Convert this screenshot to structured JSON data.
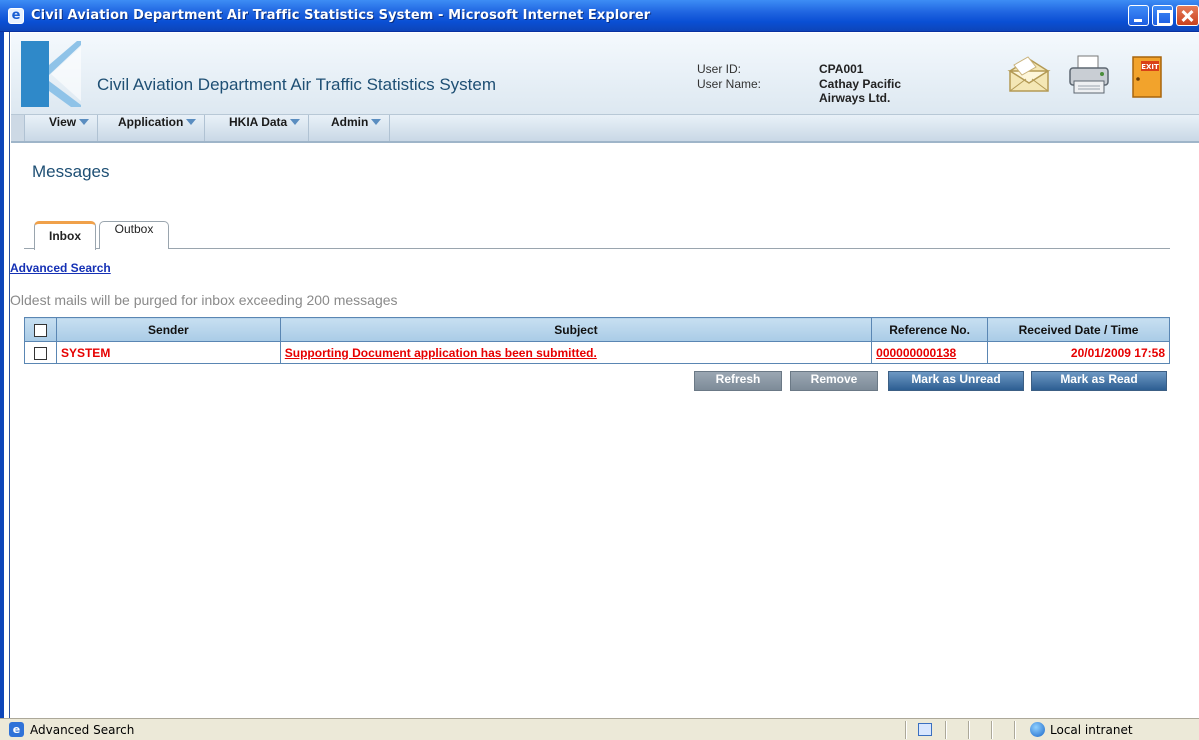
{
  "window": {
    "title": "Civil Aviation Department Air Traffic Statistics System - Microsoft Internet Explorer",
    "ie_glyph": "e"
  },
  "header": {
    "app_title": "Civil Aviation Department Air Traffic Statistics System",
    "user_id_label": "User ID:",
    "user_id": "CPA001",
    "user_name_label": "User Name:",
    "user_name_line1": "Cathay Pacific",
    "user_name_line2": "Airways Ltd.",
    "icons": [
      "envelope-icon",
      "printer-icon",
      "exit-door-icon"
    ],
    "exit_text": "EXIT"
  },
  "menu": {
    "items": [
      {
        "label": "View"
      },
      {
        "label": "Application"
      },
      {
        "label": "HKIA Data"
      },
      {
        "label": "Admin"
      }
    ]
  },
  "page": {
    "title": "Messages",
    "tabs": [
      {
        "label": "Inbox",
        "active": true
      },
      {
        "label": "Outbox",
        "active": false
      }
    ],
    "advanced_search": "Advanced Search",
    "purge_note": "Oldest mails will be purged for inbox exceeding 200 messages"
  },
  "table": {
    "columns": [
      "Sender",
      "Subject",
      "Reference No.",
      "Received Date / Time"
    ],
    "rows": [
      {
        "sender": "SYSTEM",
        "subject": "Supporting Document application has been submitted.",
        "reference": "000000000138",
        "received": "20/01/2009 17:58"
      }
    ]
  },
  "actions": {
    "refresh": "Refresh",
    "remove": "Remove",
    "mark_unread": "Mark as Unread",
    "mark_read": "Mark as Read"
  },
  "statusbar": {
    "text": "Advanced Search",
    "zone": "Local intranet"
  },
  "colors": {
    "accent": "#1e4f74",
    "unread_red": "#e60000",
    "link_blue": "#1531b5",
    "titlebar_blue": "#0a4fd4"
  }
}
